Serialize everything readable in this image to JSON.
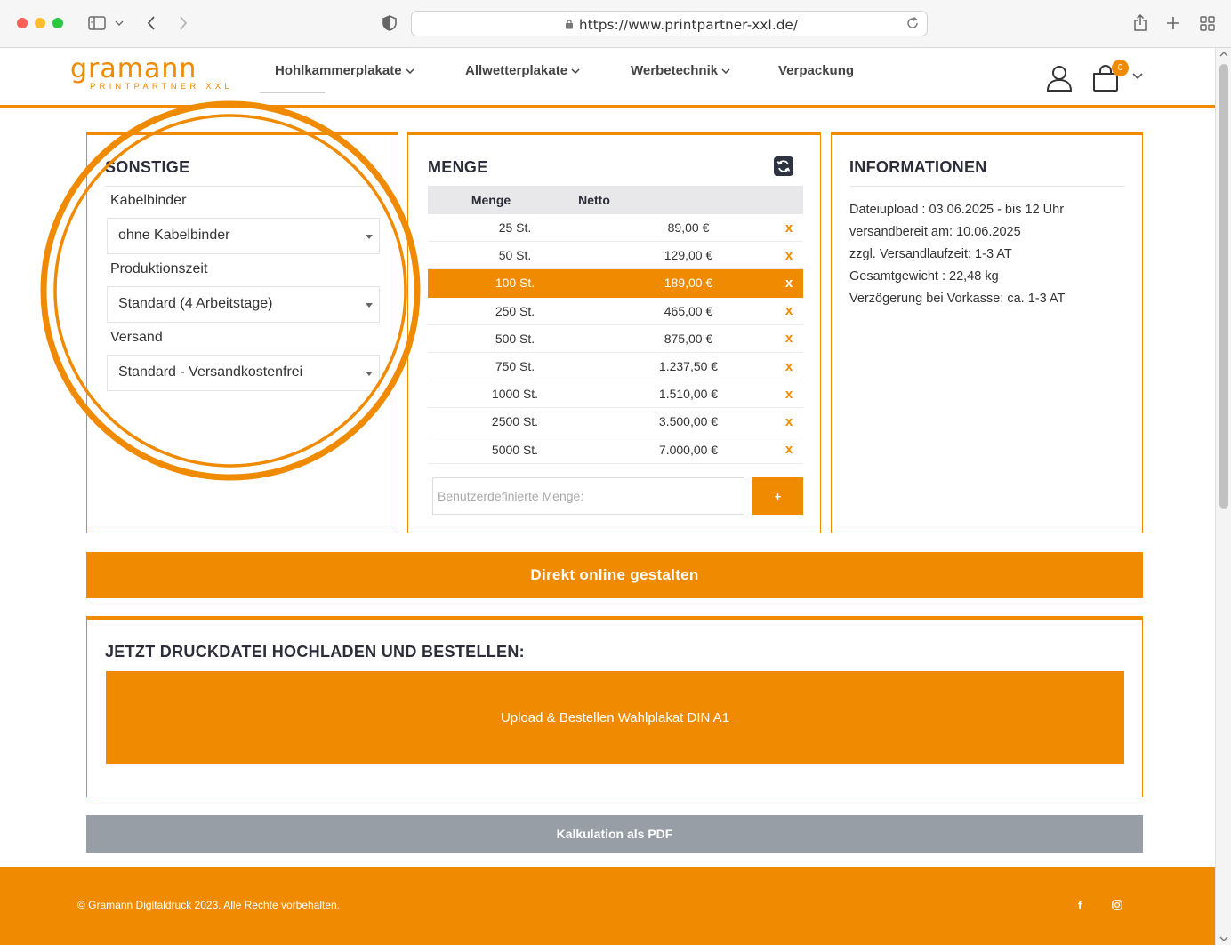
{
  "browser": {
    "url": "https://www.printpartner-xxl.de/"
  },
  "header": {
    "logo_main": "gramann",
    "logo_sub": "PRINTPARTNER",
    "logo_sub_accent": "XXL",
    "nav": [
      {
        "label": "Hohlkammerplakate",
        "has_dropdown": true
      },
      {
        "label": "Allwetterplakate",
        "has_dropdown": true
      },
      {
        "label": "Werbetechnik",
        "has_dropdown": true
      },
      {
        "label": "Verpackung",
        "has_dropdown": false
      }
    ],
    "cart_count": "0"
  },
  "sonstige": {
    "title": "SONSTIGE",
    "fields": [
      {
        "label": "Kabelbinder",
        "value": "ohne Kabelbinder"
      },
      {
        "label": "Produktionszeit",
        "value": "Standard (4 Arbeitstage)"
      },
      {
        "label": "Versand",
        "value": "Standard - Versandkostenfrei"
      }
    ]
  },
  "menge": {
    "title": "MENGE",
    "col_menge": "Menge",
    "col_netto": "Netto",
    "rows": [
      {
        "qty": "25 St.",
        "price": "89,00 €",
        "x": "x",
        "selected": false
      },
      {
        "qty": "50 St.",
        "price": "129,00 €",
        "x": "x",
        "selected": false
      },
      {
        "qty": "100 St.",
        "price": "189,00 €",
        "x": "x",
        "selected": true
      },
      {
        "qty": "250 St.",
        "price": "465,00 €",
        "x": "x",
        "selected": false
      },
      {
        "qty": "500 St.",
        "price": "875,00 €",
        "x": "x",
        "selected": false
      },
      {
        "qty": "750 St.",
        "price": "1.237,50 €",
        "x": "x",
        "selected": false
      },
      {
        "qty": "1000 St.",
        "price": "1.510,00 €",
        "x": "x",
        "selected": false
      },
      {
        "qty": "2500 St.",
        "price": "3.500,00 €",
        "x": "x",
        "selected": false
      },
      {
        "qty": "5000 St.",
        "price": "7.000,00 €",
        "x": "x",
        "selected": false
      }
    ],
    "custom_placeholder": "Benutzerdefinierte Menge:",
    "add_label": "+"
  },
  "informationen": {
    "title": "INFORMATIONEN",
    "lines": [
      "Dateiupload : 03.06.2025 - bis 12 Uhr",
      "versandbereit am: 10.06.2025",
      "zzgl. Versandlaufzeit: 1-3 AT",
      "Gesamtgewicht : 22,48 kg",
      "Verzögerung bei Vorkasse: ca. 1-3 AT"
    ]
  },
  "actions": {
    "design_label": "Direkt online gestalten",
    "upload_title": "JETZT DRUCKDATEI HOCHLADEN UND BESTELLEN:",
    "upload_label": "Upload & Bestellen Wahlplakat DIN A1",
    "pdf_label": "Kalkulation als PDF"
  },
  "footer": {
    "copyright": "© Gramann Digitaldruck 2023. Alle Rechte vorbehalten.",
    "social": [
      "f",
      "instagram"
    ]
  },
  "colors": {
    "accent": "#f08a00",
    "pdf_button": "#979ea6",
    "heading": "#2d2d3a"
  }
}
